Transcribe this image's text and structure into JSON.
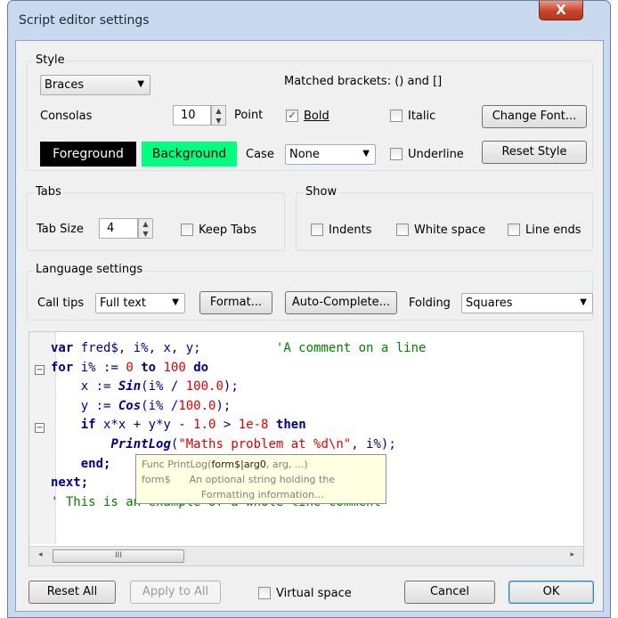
{
  "window": {
    "title": "Script editor settings",
    "close_glyph": "X"
  },
  "style": {
    "group_label": "Style",
    "style_select": "Braces",
    "matched_brackets": "Matched brackets: () and []",
    "font_name": "Consolas",
    "point_size": "10",
    "point_label": "Point",
    "bold_label": "Bold",
    "italic_label": "Italic",
    "change_font": "Change Font...",
    "foreground": "Foreground",
    "background": "Background",
    "case_label": "Case",
    "case_select": "None",
    "underline_label": "Underline",
    "reset_style": "Reset Style",
    "foreground_color": "#000000",
    "background_color": "#00ff80"
  },
  "tabs": {
    "group_label": "Tabs",
    "tab_size_label": "Tab Size",
    "tab_size": "4",
    "keep_tabs": "Keep Tabs"
  },
  "show": {
    "group_label": "Show",
    "indents": "Indents",
    "white_space": "White space",
    "line_ends": "Line ends"
  },
  "language": {
    "group_label": "Language settings",
    "call_tips_label": "Call tips",
    "call_tips_select": "Full text",
    "format": "Format...",
    "auto_complete": "Auto-Complete...",
    "folding_label": "Folding",
    "folding_select": "Squares"
  },
  "editor": {
    "line1_kw": "var",
    "line1_vars": " fred$, i%, x, y;",
    "line1_comment": "'A comment on a line",
    "line2_for": "for",
    "line2_mid": " i% := ",
    "line2_from": "0",
    "line2_to": "to",
    "line2_upto": "100",
    "line2_do": "do",
    "line3_a": "x := ",
    "line3_fn": "Sin",
    "line3_b": "(i% / ",
    "line3_num": "100.0",
    "line3_c": ");",
    "line4_a": "y := ",
    "line4_fn": "Cos",
    "line4_b": "(i% /",
    "line4_num": "100.0",
    "line4_c": ");",
    "line5_if": "if",
    "line5_a": " x*x + y*y - ",
    "line5_num1": "1.0",
    "line5_b": " > ",
    "line5_num2": "1e-8",
    "line5_then": "then",
    "line6_fn": "PrintLog",
    "line6_a": "(",
    "line6_str": "\"Maths problem at %d\\n\"",
    "line6_b": ", i%);",
    "line7_end": "end;",
    "line8_next": "next;",
    "line9_comment": "' This is an example of a whole line comment"
  },
  "calltip": {
    "line1_pre": "Func PrintLog(",
    "line1_arg": "form$|arg0",
    "line1_post": ", arg, ...)",
    "line2_name": "form$",
    "line2_desc": "An optional string holding the",
    "line3_desc": "Formatting information..."
  },
  "scrollbar": {
    "thumb_grip": "III",
    "left_arrow": "◂",
    "right_arrow": "▸"
  },
  "bottom": {
    "reset_all": "Reset All",
    "apply_to_all": "Apply to All",
    "virtual_space": "Virtual space",
    "cancel": "Cancel",
    "ok": "OK"
  }
}
